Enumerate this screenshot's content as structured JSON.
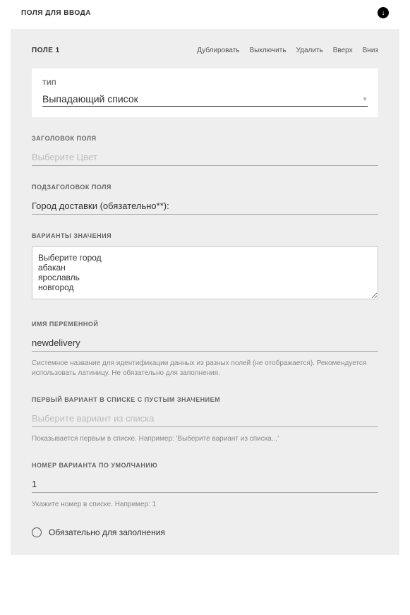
{
  "header": {
    "title": "ПОЛЯ ДЛЯ ВВОДА"
  },
  "panel": {
    "title": "ПОЛЕ 1",
    "actions": {
      "duplicate": "Дублировать",
      "disable": "Выключить",
      "delete": "Удалить",
      "up": "Вверх",
      "down": "Вниз"
    }
  },
  "type": {
    "label": "ТИП",
    "value": "Выпадающий список"
  },
  "fieldTitle": {
    "label": "ЗАГОЛОВОК ПОЛЯ",
    "placeholder": "Выберите Цвет",
    "value": ""
  },
  "subtitle": {
    "label": "ПОДЗАГОЛОВОК ПОЛЯ",
    "value": "Город доставки (обязательно**):"
  },
  "options": {
    "label": "ВАРИАНТЫ ЗНАЧЕНИЯ",
    "value": "Выберите город\nабакан\nярославль\nновгород"
  },
  "varname": {
    "label": "ИМЯ ПЕРЕМЕННОЙ",
    "value": "newdelivery",
    "hint": "Системное название для идентификации данных из разных полей (не отображается). Рекомендуется использовать латиницу. Не обязательно для заполнения."
  },
  "firstOption": {
    "label": "ПЕРВЫЙ ВАРИАНТ В СПИСКЕ С ПУСТЫМ ЗНАЧЕНИЕМ",
    "placeholder": "Выберите вариант из списка",
    "value": "",
    "hint": "Показывается первым в списке. Например: 'Выберите вариант из списка...'"
  },
  "defaultNum": {
    "label": "НОМЕР ВАРИАНТА ПО УМОЛЧАНИЮ",
    "value": "1",
    "hint": "Укажите номер в списке. Например: 1"
  },
  "required": {
    "label": "Обязательно для заполнения"
  }
}
